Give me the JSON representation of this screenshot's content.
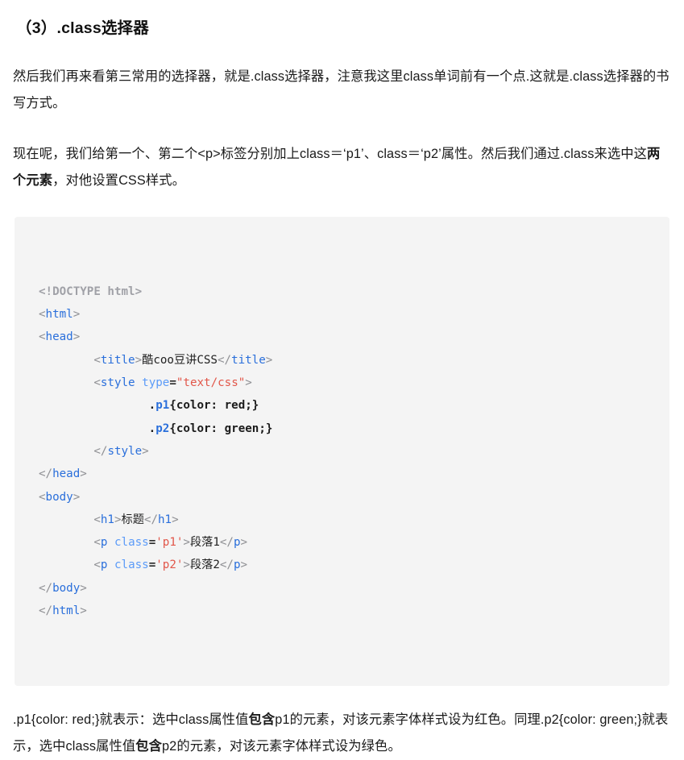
{
  "heading": "（3）.class选择器",
  "paragraphs": {
    "intro_part1": "然后我们再来看第三常用的选择器，就是.class选择器，注意我这里class单词前有一个点.这就是.class选择器的书写方式。",
    "usage_a": "现在呢，我们给第一个、第二个<p>标签分别加上class＝‘p1’、class＝‘p2’属性。然后我们通过.class来选中这",
    "usage_bold": "两个元素",
    "usage_b": "，对他设置CSS样式。",
    "explain_a": ".p1{color: red;}就表示：选中class属性值",
    "explain_bold1": "包含",
    "explain_b": "p1的元素，对该元素字体样式设为红色。同理.p2{color: green;}就表示，选中class属性值",
    "explain_bold2": "包含",
    "explain_c": "p2的元素，对该元素字体样式设为绿色。"
  },
  "code": {
    "language": "html",
    "lines": [
      {
        "indent": 0,
        "tokens": [
          {
            "t": "doctype",
            "v": "<!DOCTYPE html>"
          }
        ]
      },
      {
        "indent": 0,
        "tokens": [
          {
            "t": "punct",
            "v": "<"
          },
          {
            "t": "tag",
            "v": "html"
          },
          {
            "t": "punct",
            "v": ">"
          }
        ]
      },
      {
        "indent": 0,
        "tokens": [
          {
            "t": "punct",
            "v": "<"
          },
          {
            "t": "tag",
            "v": "head"
          },
          {
            "t": "punct",
            "v": ">"
          }
        ]
      },
      {
        "indent": 8,
        "tokens": [
          {
            "t": "punct",
            "v": "<"
          },
          {
            "t": "tag",
            "v": "title"
          },
          {
            "t": "punct",
            "v": ">"
          },
          {
            "t": "cn",
            "v": "酷coo豆讲CSS"
          },
          {
            "t": "punct",
            "v": "</"
          },
          {
            "t": "tag",
            "v": "title"
          },
          {
            "t": "punct",
            "v": ">"
          }
        ]
      },
      {
        "indent": 8,
        "tokens": [
          {
            "t": "punct",
            "v": "<"
          },
          {
            "t": "tag",
            "v": "style"
          },
          {
            "t": "text",
            "v": " "
          },
          {
            "t": "attr",
            "v": "type"
          },
          {
            "t": "eq",
            "v": "="
          },
          {
            "t": "string",
            "v": "\"text/css\""
          },
          {
            "t": "punct",
            "v": ">"
          }
        ]
      },
      {
        "indent": 16,
        "tokens": [
          {
            "t": "css",
            "v": "."
          },
          {
            "t": "sel",
            "v": "p1"
          },
          {
            "t": "css",
            "v": "{color: red;}"
          }
        ]
      },
      {
        "indent": 16,
        "tokens": [
          {
            "t": "css",
            "v": "."
          },
          {
            "t": "sel",
            "v": "p2"
          },
          {
            "t": "css",
            "v": "{color: green;}"
          }
        ]
      },
      {
        "indent": 8,
        "tokens": [
          {
            "t": "punct",
            "v": "</"
          },
          {
            "t": "tag",
            "v": "style"
          },
          {
            "t": "punct",
            "v": ">"
          }
        ]
      },
      {
        "indent": 0,
        "tokens": [
          {
            "t": "punct",
            "v": "</"
          },
          {
            "t": "tag",
            "v": "head"
          },
          {
            "t": "punct",
            "v": ">"
          }
        ]
      },
      {
        "indent": 0,
        "tokens": [
          {
            "t": "punct",
            "v": "<"
          },
          {
            "t": "tag",
            "v": "body"
          },
          {
            "t": "punct",
            "v": ">"
          }
        ]
      },
      {
        "indent": 8,
        "tokens": [
          {
            "t": "punct",
            "v": "<"
          },
          {
            "t": "tag",
            "v": "h1"
          },
          {
            "t": "punct",
            "v": ">"
          },
          {
            "t": "cn",
            "v": "标题"
          },
          {
            "t": "punct",
            "v": "</"
          },
          {
            "t": "tag",
            "v": "h1"
          },
          {
            "t": "punct",
            "v": ">"
          }
        ]
      },
      {
        "indent": 8,
        "tokens": [
          {
            "t": "punct",
            "v": "<"
          },
          {
            "t": "tag",
            "v": "p"
          },
          {
            "t": "text",
            "v": " "
          },
          {
            "t": "attr",
            "v": "class"
          },
          {
            "t": "eq",
            "v": "="
          },
          {
            "t": "string",
            "v": "'p1'"
          },
          {
            "t": "punct",
            "v": ">"
          },
          {
            "t": "cn",
            "v": "段落1"
          },
          {
            "t": "punct",
            "v": "</"
          },
          {
            "t": "tag",
            "v": "p"
          },
          {
            "t": "punct",
            "v": ">"
          }
        ]
      },
      {
        "indent": 8,
        "tokens": [
          {
            "t": "punct",
            "v": "<"
          },
          {
            "t": "tag",
            "v": "p"
          },
          {
            "t": "text",
            "v": " "
          },
          {
            "t": "attr",
            "v": "class"
          },
          {
            "t": "eq",
            "v": "="
          },
          {
            "t": "string",
            "v": "'p2'"
          },
          {
            "t": "punct",
            "v": ">"
          },
          {
            "t": "cn",
            "v": "段落2"
          },
          {
            "t": "punct",
            "v": "</"
          },
          {
            "t": "tag",
            "v": "p"
          },
          {
            "t": "punct",
            "v": ">"
          }
        ]
      },
      {
        "indent": 0,
        "tokens": [
          {
            "t": "punct",
            "v": "</"
          },
          {
            "t": "tag",
            "v": "body"
          },
          {
            "t": "punct",
            "v": ">"
          }
        ]
      },
      {
        "indent": 0,
        "tokens": [
          {
            "t": "punct",
            "v": "</"
          },
          {
            "t": "tag",
            "v": "html"
          },
          {
            "t": "punct",
            "v": ">"
          }
        ]
      }
    ]
  },
  "colors": {
    "code_background": "#f4f4f4",
    "tag": "#2a6fdb",
    "attribute": "#5b9bf8",
    "string": "#e2574a",
    "doctype": "#a0a1a7",
    "punctuation": "#8f9094",
    "text": "#1a1a1a"
  }
}
